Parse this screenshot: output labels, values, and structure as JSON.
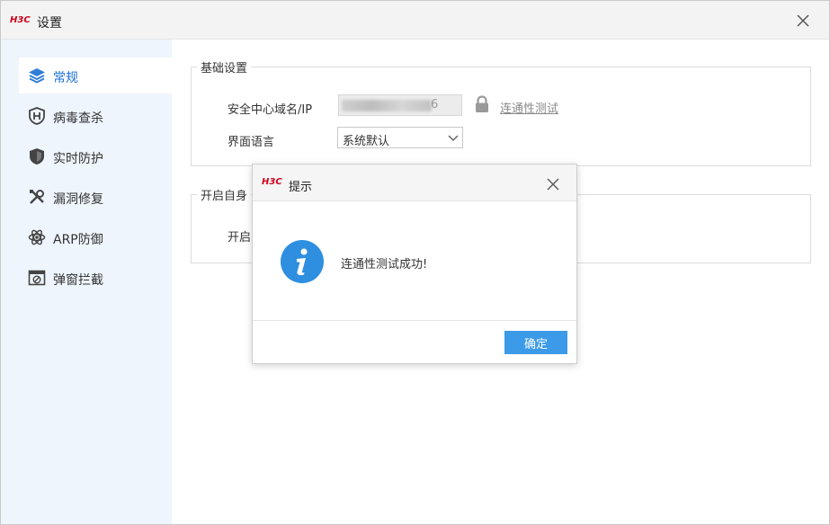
{
  "window": {
    "logo": "H3C",
    "title": "设置"
  },
  "sidebar": {
    "items": [
      {
        "label": "常规",
        "icon": "layers-icon",
        "active": true
      },
      {
        "label": "病毒查杀",
        "icon": "shield-h-icon"
      },
      {
        "label": "实时防护",
        "icon": "shield-icon"
      },
      {
        "label": "漏洞修复",
        "icon": "tools-icon"
      },
      {
        "label": "ARP防御",
        "icon": "atom-icon"
      },
      {
        "label": "弹窗拦截",
        "icon": "popup-block-icon"
      }
    ]
  },
  "basic": {
    "title": "基础设置",
    "domain_label": "安全中心域名/IP",
    "domain_value_tail": "6",
    "conn_test": "连通性测试",
    "lang_label": "界面语言",
    "lang_value": "系统默认"
  },
  "self": {
    "title": "开启自身",
    "row_label": "开启"
  },
  "dialog": {
    "logo": "H3C",
    "title": "提示",
    "message": "连通性测试成功!",
    "ok": "确定"
  },
  "colors": {
    "accent": "#3c9be8",
    "brand": "#d0021b",
    "sidebar_bg": "#eef5fc"
  }
}
